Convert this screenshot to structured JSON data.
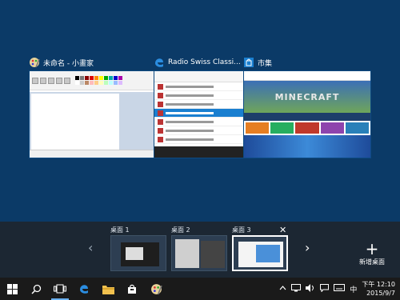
{
  "windows": [
    {
      "title": "未命名 - 小畫家",
      "icon": "paint-icon"
    },
    {
      "title": "Radio Swiss Classi...",
      "icon": "edge-icon"
    },
    {
      "title": "市集",
      "icon": "store-icon"
    }
  ],
  "store_banner": "MINECRAFT",
  "desktops": [
    {
      "label": "桌面 1"
    },
    {
      "label": "桌面 2"
    },
    {
      "label": "桌面 3"
    }
  ],
  "new_desktop_label": "新增桌面",
  "close_symbol": "✕",
  "taskbar": {
    "apps": [
      "start-icon",
      "search-icon",
      "task-view-icon",
      "edge-icon",
      "file-explorer-icon",
      "store-icon",
      "paint-icon"
    ],
    "ime": "中",
    "time": "下午 12:10",
    "date": "2015/9/7"
  },
  "colors": {
    "background": "#0b3a67",
    "bar": "#1c2733",
    "taskbar": "#1a1a1a",
    "accent": "#1a7fd0"
  }
}
